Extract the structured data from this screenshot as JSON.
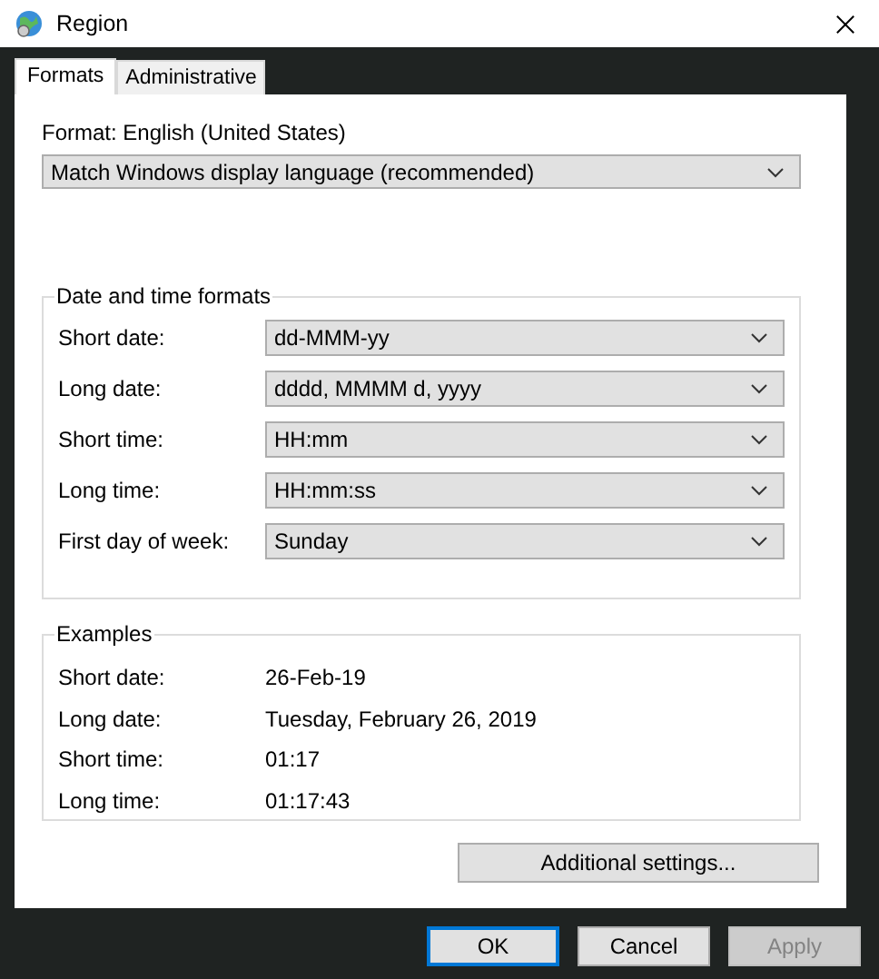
{
  "window": {
    "title": "Region"
  },
  "tabs": [
    {
      "label": "Formats",
      "selected": true
    },
    {
      "label": "Administrative",
      "selected": false
    }
  ],
  "format": {
    "label": "Format: English (United States)",
    "value": "Match Windows display language (recommended)"
  },
  "date_time_formats": {
    "title": "Date and time formats",
    "rows": [
      {
        "label": "Short date:",
        "value": "dd-MMM-yy"
      },
      {
        "label": "Long date:",
        "value": "dddd, MMMM d, yyyy"
      },
      {
        "label": "Short time:",
        "value": "HH:mm"
      },
      {
        "label": "Long time:",
        "value": "HH:mm:ss"
      },
      {
        "label": "First day of week:",
        "value": "Sunday"
      }
    ]
  },
  "examples": {
    "title": "Examples",
    "rows": [
      {
        "label": "Short date:",
        "value": "26-Feb-19"
      },
      {
        "label": "Long date:",
        "value": "Tuesday, February 26, 2019"
      },
      {
        "label": "Short time:",
        "value": "01:17"
      },
      {
        "label": "Long time:",
        "value": "01:17:43"
      }
    ]
  },
  "additional_button": "Additional settings...",
  "buttons": [
    {
      "label": "OK",
      "kind": "default",
      "disabled": false
    },
    {
      "label": "Cancel",
      "kind": "normal",
      "disabled": false
    },
    {
      "label": "Apply",
      "kind": "normal",
      "disabled": true
    }
  ]
}
